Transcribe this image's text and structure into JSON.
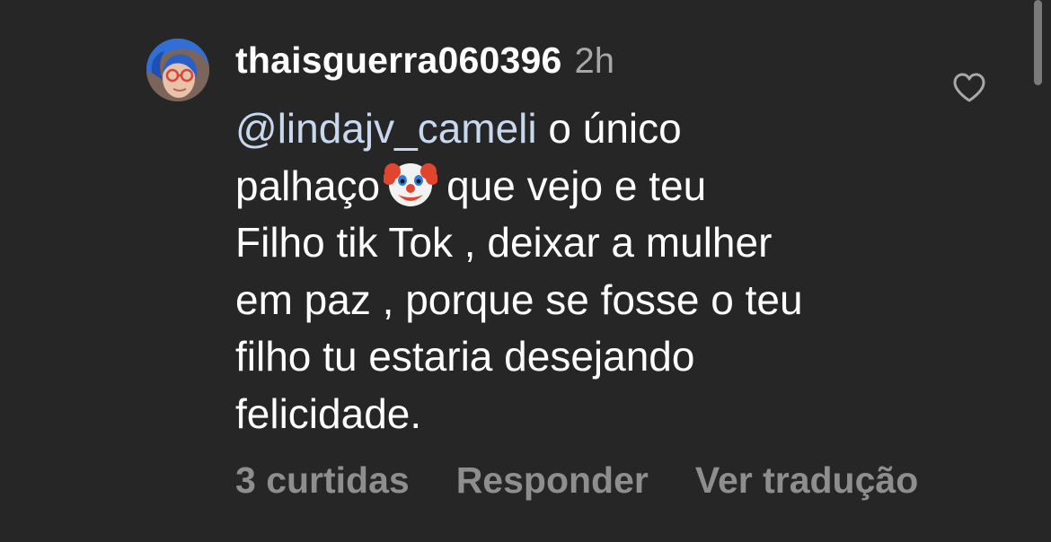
{
  "comment": {
    "username": "thaisguerra060396",
    "time": "2h",
    "avatar_icon": "user-avatar-icon",
    "like_icon": "heart-outline-icon",
    "text": {
      "mention": "@lindajv_cameli",
      "line1_rest": " o único",
      "line2_before_emoji": "palhaço",
      "emoji_icon": "clown-face-icon",
      "line2_after_emoji": "que vejo e teu",
      "line3": "Filho tik Tok , deixar a mulher",
      "line4": "em paz , porque se fosse o teu",
      "line5": "filho tu estaria desejando",
      "line6": "felicidade."
    },
    "actions": {
      "likes": "3 curtidas",
      "reply": "Responder",
      "translate": "Ver tradução"
    }
  },
  "colors": {
    "background": "#262626",
    "text": "#ffffff",
    "secondary": "#a8a8a8",
    "action": "#8e8e8e",
    "mention": "#c7d8ef"
  }
}
